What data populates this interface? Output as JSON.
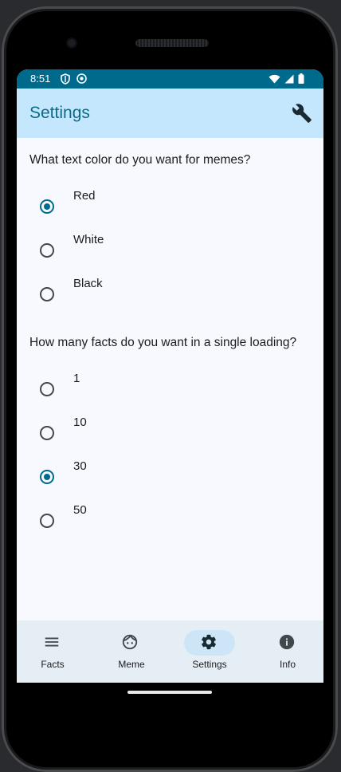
{
  "status_bar": {
    "time": "8:51",
    "left_icons": [
      "shield-icon",
      "badge-icon"
    ],
    "right_icons": [
      "wifi-icon",
      "signal-icon",
      "battery-icon"
    ]
  },
  "app_bar": {
    "title": "Settings",
    "action_icon": "wrench-icon"
  },
  "meme_color": {
    "question": "What text color do you want for memes?",
    "options": [
      {
        "label": "Red",
        "selected": true
      },
      {
        "label": "White",
        "selected": false
      },
      {
        "label": "Black",
        "selected": false
      }
    ]
  },
  "facts_count": {
    "question": "How many facts do you want in a single loading?",
    "options": [
      {
        "label": "1",
        "selected": false
      },
      {
        "label": "10",
        "selected": false
      },
      {
        "label": "30",
        "selected": true
      },
      {
        "label": "50",
        "selected": false
      }
    ]
  },
  "bottom_nav": {
    "items": [
      {
        "label": "Facts",
        "icon": "menu-icon",
        "active": false
      },
      {
        "label": "Meme",
        "icon": "face-icon",
        "active": false
      },
      {
        "label": "Settings",
        "icon": "gear-icon",
        "active": true
      },
      {
        "label": "Info",
        "icon": "info-icon",
        "active": false
      }
    ]
  },
  "colors": {
    "status_bar": "#006a8c",
    "app_bar": "#c5e7fd",
    "title": "#0b6b8a",
    "accent": "#006a8c",
    "nav_bar": "#e6eef5",
    "nav_active_pill": "#cce6f7",
    "background": "#f8f9fe"
  }
}
